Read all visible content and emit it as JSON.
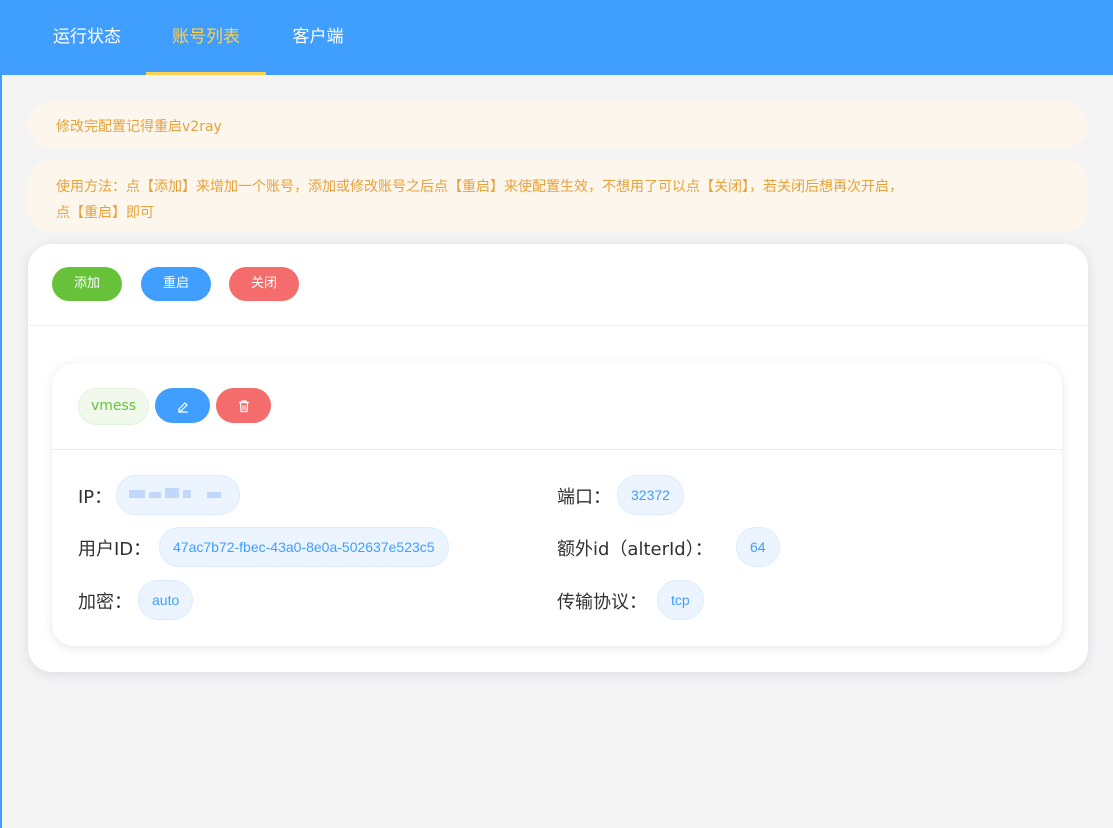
{
  "nav": {
    "tabs": [
      {
        "label": "运行状态"
      },
      {
        "label": "账号列表"
      },
      {
        "label": "客户端"
      }
    ],
    "active_index": 1,
    "colors": {
      "bg": "#409eff",
      "active": "#ffd04b"
    }
  },
  "alerts": {
    "restart_reminder": "修改完配置记得重启v2ray",
    "usage_line1": "使用方法：点【添加】来增加一个账号，添加或修改账号之后点【重启】来使配置生效，不想用了可以点【关闭】，若关闭后想再次开启，",
    "usage_line2": "点【重启】即可"
  },
  "toolbar": {
    "add_label": "添加",
    "restart_label": "重启",
    "close_label": "关闭"
  },
  "account": {
    "protocol_tag": "vmess",
    "edit_icon": "pencil-icon",
    "delete_icon": "trash-icon",
    "fields": {
      "ip_label": "IP：",
      "ip_value": "",
      "port_label": "端口：",
      "port_value": "32372",
      "uuid_label": "用户ID：",
      "uuid_value": "47ac7b72-fbec-43a0-8e0a-502637e523c5",
      "alterid_label": "额外id（alterId）：",
      "alterid_value": "64",
      "security_label": "加密：",
      "security_value": "auto",
      "network_label": "传输协议：",
      "network_value": "tcp"
    }
  }
}
